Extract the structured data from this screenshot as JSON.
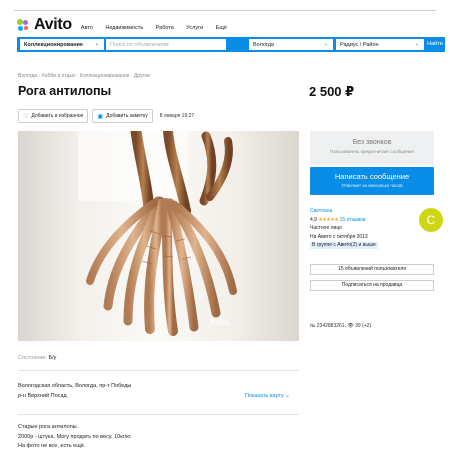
{
  "header": {
    "logo": "Avito",
    "nav": [
      "Авто",
      "Недвижимость",
      "Работа",
      "Услуги",
      "Ещё"
    ]
  },
  "search": {
    "category": "Коллекционирование",
    "placeholder": "Поиск по объявлениям",
    "city": "Вологда",
    "radius": "Радиус / Район",
    "button": "Найти"
  },
  "breadcrumbs": "Вологда · Хобби и отдых · Коллекционирование · Другое",
  "listing": {
    "title": "Рога антилопы",
    "price": "2 500 ₽",
    "favorite_label": "Добавить в избранное",
    "note_label": "Добавить заметку",
    "date": "8 января 19:27",
    "watermark": "Avito",
    "condition_label": "Состояние:",
    "condition_value": "Б/у",
    "address_line1": "Вологодская область, Вологда, пр-т Победы",
    "address_line2": "р-н Верхний Посад",
    "map_link": "Показать карту ⌄",
    "description": [
      "Старые рога антилопы.",
      "2000р - штука. Могу продать по весу. 10кг/кг.",
      "На фото не все, есть ещё."
    ]
  },
  "contact": {
    "no_calls_title": "Без звонков",
    "no_calls_sub": "Пользователь предпочитает сообщения",
    "write_title": "Написать сообщение",
    "write_sub": "Отвечает за несколько часов"
  },
  "seller": {
    "name": "Светлана",
    "rating": "4,9",
    "stars": "★★★★★",
    "reviews": "15 отзывов",
    "type": "Частное лицо",
    "since": "На Авито с октября 2013",
    "badge": "В группе с Авито(2) и выше",
    "avatar_letter": "С",
    "avatar_color": "#cfd613",
    "all_ads": "15 объявлений пользователя",
    "subscribe": "Подписаться на продавца"
  },
  "ad_meta": "№ 2342883261,  👁 39 (+2)",
  "colors": {
    "accent": "#0a8de6",
    "star": "#f5a623"
  }
}
